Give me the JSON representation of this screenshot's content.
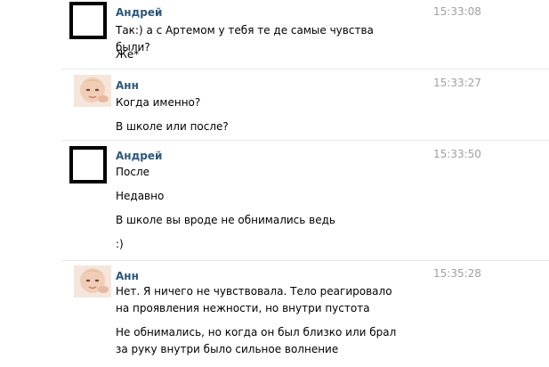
{
  "messages": [
    {
      "author": "Андрей",
      "time": "15:33:08",
      "avatar": "black-square-avatar",
      "lines": [
        "Так:) а с Артемом у тебя те де самые чувства были?",
        "Же*"
      ]
    },
    {
      "author": "Анн",
      "time": "15:33:27",
      "avatar": "baby-photo-avatar",
      "lines": [
        "Когда именно?",
        "В школе или после?"
      ]
    },
    {
      "author": "Андрей",
      "time": "15:33:50",
      "avatar": "black-square-avatar",
      "lines": [
        "После",
        "Недавно",
        "В школе вы вроде не обнимались ведь",
        ":)"
      ]
    },
    {
      "author": "Анн",
      "time": "15:35:28",
      "avatar": "baby-photo-avatar",
      "lines": [
        "Нет. Я ничего не чувствовала. Тело реагировало на проявления нежности, но внутри пустота",
        "Не обнимались, но когда он был близко или брал за руку внутри было сильное волнение"
      ]
    }
  ],
  "colors": {
    "author": "#2b587a",
    "time": "#a0a0a0",
    "text": "#000000",
    "separator": "#e6e9ee"
  }
}
